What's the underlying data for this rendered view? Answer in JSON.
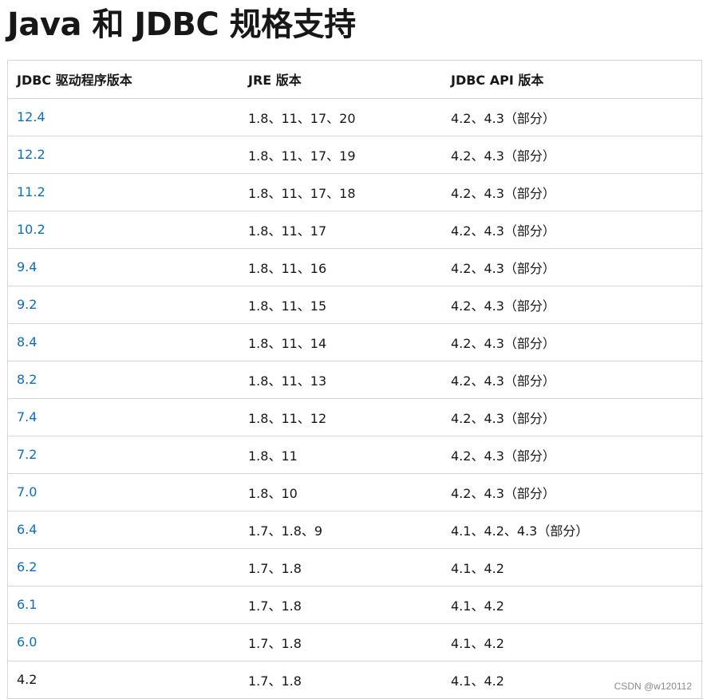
{
  "page": {
    "title": "Java 和 JDBC 规格支持",
    "watermark": "CSDN @w120112"
  },
  "table": {
    "headers": [
      "JDBC 驱动程序版本",
      "JRE 版本",
      "JDBC API 版本"
    ],
    "rows": [
      {
        "driver": "12.4",
        "jre": "1.8、11、17、20",
        "api": "4.2、4.3（部分）",
        "link": true
      },
      {
        "driver": "12.2",
        "jre": "1.8、11、17、19",
        "api": "4.2、4.3（部分）",
        "link": true
      },
      {
        "driver": "11.2",
        "jre": "1.8、11、17、18",
        "api": "4.2、4.3（部分）",
        "link": true
      },
      {
        "driver": "10.2",
        "jre": "1.8、11、17",
        "api": "4.2、4.3（部分）",
        "link": true
      },
      {
        "driver": "9.4",
        "jre": "1.8、11、16",
        "api": "4.2、4.3（部分）",
        "link": true
      },
      {
        "driver": "9.2",
        "jre": "1.8、11、15",
        "api": "4.2、4.3（部分）",
        "link": true
      },
      {
        "driver": "8.4",
        "jre": "1.8、11、14",
        "api": "4.2、4.3（部分）",
        "link": true
      },
      {
        "driver": "8.2",
        "jre": "1.8、11、13",
        "api": "4.2、4.3（部分）",
        "link": true
      },
      {
        "driver": "7.4",
        "jre": "1.8、11、12",
        "api": "4.2、4.3（部分）",
        "link": true
      },
      {
        "driver": "7.2",
        "jre": "1.8、11",
        "api": "4.2、4.3（部分）",
        "link": true
      },
      {
        "driver": "7.0",
        "jre": "1.8、10",
        "api": "4.2、4.3（部分）",
        "link": true
      },
      {
        "driver": "6.4",
        "jre": "1.7、1.8、9",
        "api": "4.1、4.2、4.3（部分）",
        "link": true
      },
      {
        "driver": "6.2",
        "jre": "1.7、1.8",
        "api": "4.1、4.2",
        "link": true
      },
      {
        "driver": "6.1",
        "jre": "1.7、1.8",
        "api": "4.1、4.2",
        "link": true
      },
      {
        "driver": "6.0",
        "jre": "1.7、1.8",
        "api": "4.1、4.2",
        "link": true
      },
      {
        "driver": "4.2",
        "jre": "1.7、1.8",
        "api": "4.1、4.2",
        "link": false
      }
    ]
  }
}
